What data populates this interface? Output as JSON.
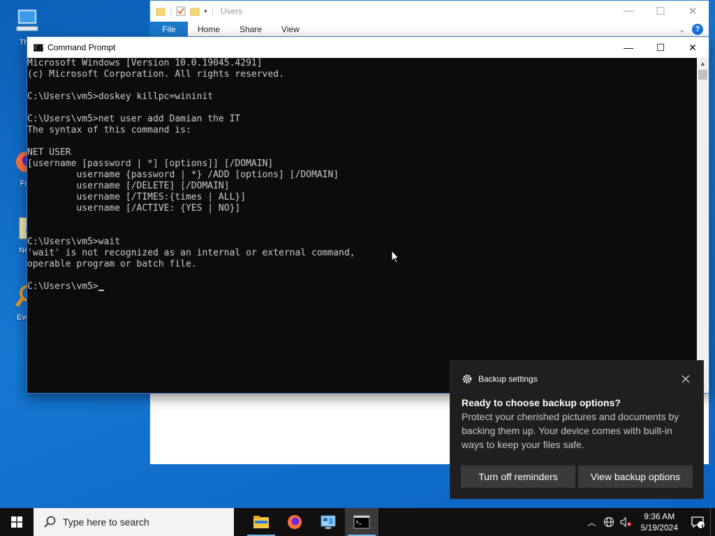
{
  "desktop": {
    "icons": [
      {
        "label": "This"
      },
      {
        "label": "Fire"
      },
      {
        "label": "New"
      },
      {
        "label": "Every"
      }
    ]
  },
  "explorer": {
    "title": "Users",
    "tabs": [
      "File",
      "Home",
      "Share",
      "View"
    ],
    "help": "?"
  },
  "cmd": {
    "title": "Command Prompt",
    "lines": [
      "Microsoft Windows [Version 10.0.19045.4291]",
      "(c) Microsoft Corporation. All rights reserved.",
      "",
      "C:\\Users\\vm5>doskey killpc=wininit",
      "",
      "C:\\Users\\vm5>net user add Damian the IT",
      "The syntax of this command is:",
      "",
      "NET USER",
      "[username [password | *] [options]] [/DOMAIN]",
      "         username {password | *} /ADD [options] [/DOMAIN]",
      "         username [/DELETE] [/DOMAIN]",
      "         username [/TIMES:{times | ALL}]",
      "         username [/ACTIVE: {YES | NO}]",
      "",
      "",
      "C:\\Users\\vm5>wait",
      "'wait' is not recognized as an internal or external command,",
      "operable program or batch file.",
      ""
    ],
    "prompt": "C:\\Users\\vm5>"
  },
  "toast": {
    "app": "Backup settings",
    "heading": "Ready to choose backup options?",
    "body": "Protect your cherished pictures and documents by backing them up. Your device comes with built-in ways to keep your files safe.",
    "button_1": "Turn off reminders",
    "button_2": "View backup options"
  },
  "taskbar": {
    "search_placeholder": "Type here to search",
    "time": "9:36 AM",
    "date": "5/19/2024",
    "notification_count": "1"
  },
  "colors": {
    "console_bg": "#0c0c0c",
    "console_fg": "#cccccc",
    "accent": "#1979ca",
    "toast_bg": "#1f1f1f"
  }
}
